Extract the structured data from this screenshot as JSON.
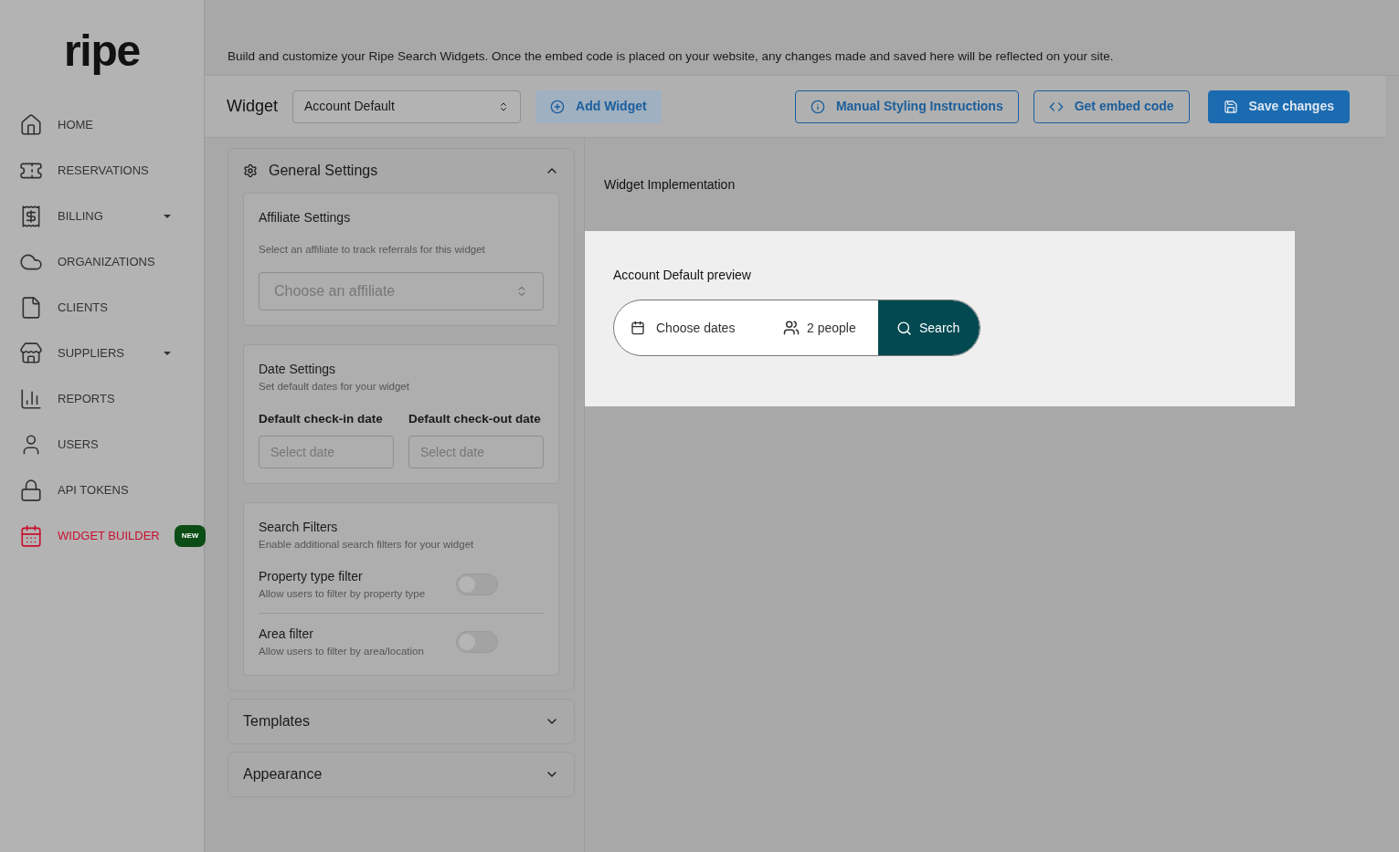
{
  "logo": "ripe",
  "sidebar": {
    "items": [
      {
        "label": "HOME",
        "selected": false,
        "expandable": false
      },
      {
        "label": "RESERVATIONS",
        "selected": false,
        "expandable": false
      },
      {
        "label": "BILLING",
        "selected": false,
        "expandable": true
      },
      {
        "label": "ORGANIZATIONS",
        "selected": false,
        "expandable": false
      },
      {
        "label": "CLIENTS",
        "selected": false,
        "expandable": false
      },
      {
        "label": "SUPPLIERS",
        "selected": false,
        "expandable": true
      },
      {
        "label": "REPORTS",
        "selected": false,
        "expandable": false
      },
      {
        "label": "USERS",
        "selected": false,
        "expandable": false
      },
      {
        "label": "API TOKENS",
        "selected": false,
        "expandable": false
      },
      {
        "label": "WIDGET BUILDER",
        "selected": true,
        "expandable": false,
        "badge": "NEW"
      }
    ]
  },
  "intro": "Build and customize your Ripe Search Widgets. Once the embed code is placed on your website, any changes made and saved here will be reflected on your site.",
  "toolbar": {
    "label": "Widget",
    "select_value": "Account Default",
    "add_button": "Add Widget",
    "buttons": [
      {
        "label": "Manual Styling Instructions",
        "kind": "info",
        "primary": false
      },
      {
        "label": "Get embed code",
        "kind": "code",
        "primary": false
      },
      {
        "label": "Save changes",
        "kind": "save",
        "primary": true
      }
    ]
  },
  "sections": [
    {
      "title": "General Settings",
      "expanded": true,
      "affiliate": {
        "title": "Affiliate Settings",
        "description": "Select an affiliate to track referrals for this widget",
        "placeholder": "Choose an affiliate"
      },
      "dates": {
        "title": "Date Settings",
        "description": "Set default dates for your widget",
        "fields": [
          {
            "label": "Default check-in date",
            "placeholder": "Select date"
          },
          {
            "label": "Default check-out date",
            "placeholder": "Select date"
          }
        ]
      },
      "filters": {
        "title": "Search Filters",
        "description": "Enable additional search filters for your widget",
        "items": [
          {
            "label": "Property type filter",
            "description": "Allow users to filter by property type",
            "on": false
          },
          {
            "label": "Area filter",
            "description": "Allow users to filter by area/location",
            "on": false
          }
        ]
      }
    },
    {
      "title": "Templates",
      "expanded": false
    },
    {
      "title": "Appearance",
      "expanded": false
    }
  ],
  "implementation": {
    "title": "Widget Implementation",
    "preview_title": "Account Default preview",
    "dates_placeholder": "Choose dates",
    "guests": "2 people",
    "search_button": "Search"
  }
}
